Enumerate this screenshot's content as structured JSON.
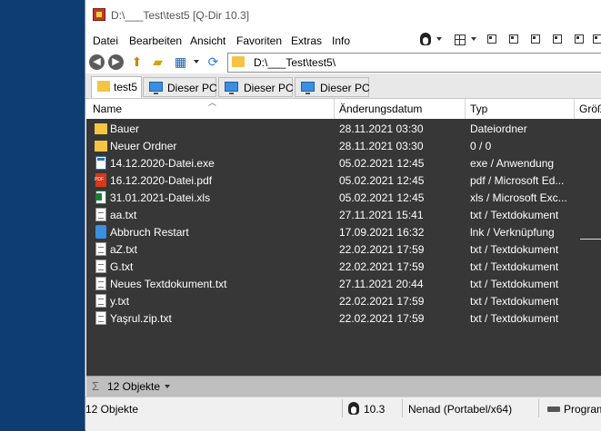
{
  "window": {
    "title": "D:\\___Test\\test5  [Q-Dir 10.3]"
  },
  "menu": [
    "Datei",
    "Bearbeiten",
    "Ansicht",
    "Favoriten",
    "Extras",
    "Info"
  ],
  "address": {
    "value": "D:\\___Test\\test5\\"
  },
  "tabs": [
    {
      "label": "test5",
      "icon": "folder-icon",
      "active": true
    },
    {
      "label": "Dieser PC",
      "icon": "computer-icon"
    },
    {
      "label": "Dieser PC",
      "icon": "computer-icon"
    },
    {
      "label": "Dieser PC",
      "icon": "computer-icon"
    }
  ],
  "columns": {
    "name": "Name",
    "date": "Änderungsdatum",
    "type": "Typ",
    "size": "Größ"
  },
  "files": [
    {
      "name": "Bauer",
      "date": "28.11.2021 03:30",
      "type": "Dateiordner",
      "icon": "folder"
    },
    {
      "name": "Neuer Ordner",
      "date": "28.11.2021 03:30",
      "type": "0 / 0",
      "icon": "folder"
    },
    {
      "name": "14.12.2020-Datei.exe",
      "date": "05.02.2021 12:45",
      "type": "exe / Anwendung",
      "icon": "exe"
    },
    {
      "name": "16.12.2020-Datei.pdf",
      "date": "05.02.2021 12:45",
      "type": "pdf / Microsoft Ed...",
      "icon": "pdf"
    },
    {
      "name": "31.01.2021-Datei.xls",
      "date": "05.02.2021 12:45",
      "type": "xls / Microsoft Exc...",
      "icon": "xls"
    },
    {
      "name": "aa.txt",
      "date": "27.11.2021 15:41",
      "type": "txt / Textdokument",
      "icon": "txt"
    },
    {
      "name": "Abbruch Restart",
      "date": "17.09.2021 16:32",
      "type": "lnk / Verknüpfung",
      "icon": "lnk"
    },
    {
      "name": "aZ.txt",
      "date": "22.02.2021 17:59",
      "type": "txt / Textdokument",
      "icon": "txt"
    },
    {
      "name": "G.txt",
      "date": "22.02.2021 17:59",
      "type": "txt / Textdokument",
      "icon": "txt"
    },
    {
      "name": "Neues Textdokument.txt",
      "date": "27.11.2021 20:44",
      "type": "txt / Textdokument",
      "icon": "txt"
    },
    {
      "name": "y.txt",
      "date": "22.02.2021 17:59",
      "type": "txt / Textdokument",
      "icon": "txt"
    },
    {
      "name": "Yaşrul.zip.txt",
      "date": "22.02.2021 17:59",
      "type": "txt / Textdokument",
      "icon": "txt"
    }
  ],
  "summary": {
    "sigma": "Σ",
    "text": "12 Objekte"
  },
  "status": {
    "count": "12 Objekte",
    "version": "10.3",
    "edition": "Nenad (Portabel/x64)",
    "extra": "Program"
  },
  "colors": {
    "list_bg": "#373737",
    "desktop": "#0b3a6e",
    "folder": "#f5c542"
  }
}
